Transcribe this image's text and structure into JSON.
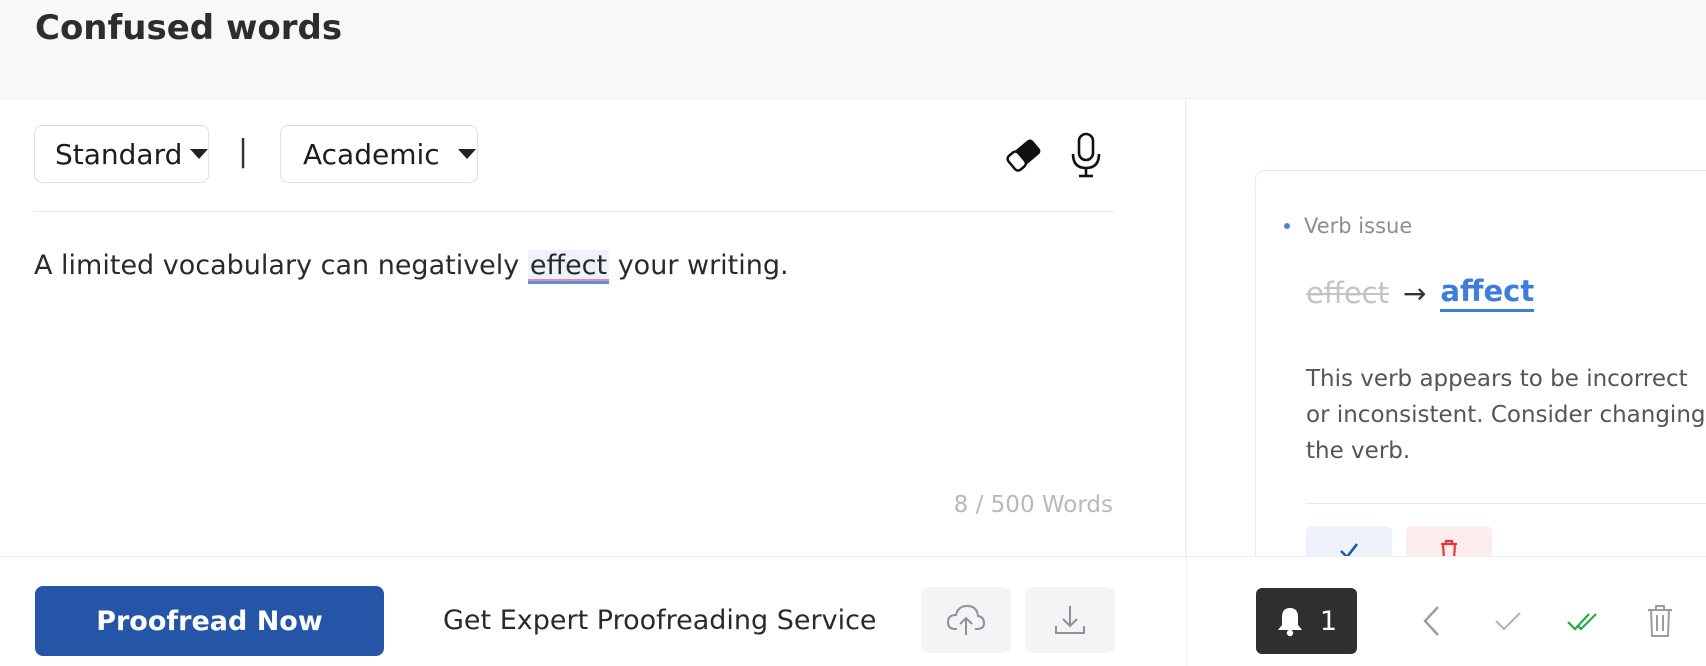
{
  "page": {
    "title": "Confused words"
  },
  "toolbar": {
    "dialect": "Standard",
    "separator": "|",
    "style": "Academic",
    "icons": [
      "eraser-icon",
      "microphone-icon"
    ]
  },
  "editor": {
    "text_before": "A limited vocabulary can negatively ",
    "error_word": "effect",
    "text_after": " your writing.",
    "word_count": "8 / 500 Words"
  },
  "suggestion": {
    "issue_type": "Verb issue",
    "original": "effect",
    "arrow": "→",
    "replacement": "affect",
    "explanation": "This verb appears to be incorrect or inconsistent. Consider changing the verb."
  },
  "footer": {
    "proofread_label": "Proofread Now",
    "expert_label": "Get Expert Proofreading Service",
    "notification_count": "1"
  },
  "colors": {
    "primary": "#2555a6",
    "accent": "#3f7ddc",
    "success": "#2aa84a",
    "danger": "#e0393e",
    "dark": "#2f2f31"
  }
}
